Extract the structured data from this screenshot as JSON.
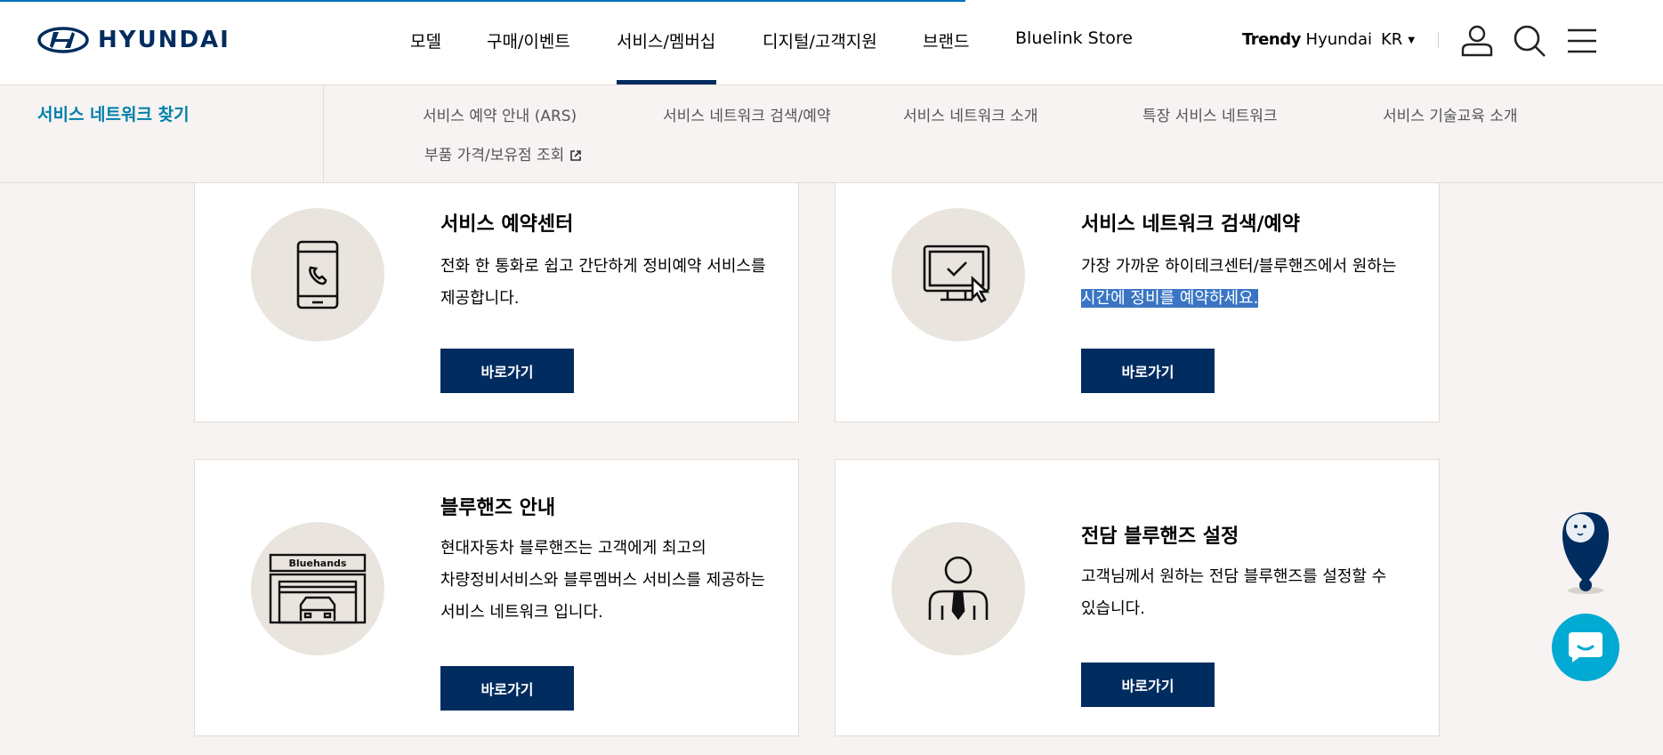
{
  "header": {
    "logo_text": "HYUNDAI",
    "nav": [
      {
        "label": "모델"
      },
      {
        "label": "구매/이벤트"
      },
      {
        "label": "서비스/멤버십"
      },
      {
        "label": "디지털/고객지원"
      },
      {
        "label": "브랜드"
      },
      {
        "label": "Bluelink Store"
      }
    ],
    "active_nav": "서비스/멤버십",
    "trendy_bold": "Trendy",
    "trendy_rest": " Hyundai",
    "lang": "KR",
    "lang_caret": "▼",
    "icons": [
      "user-icon",
      "search-icon",
      "menu-icon"
    ]
  },
  "subnav": {
    "title": "서비스 네트워크 찾기",
    "links": [
      "서비스 예약 안내 (ARS)",
      "서비스 네트워크 검색/예약",
      "서비스 네트워크 소개",
      "특장 서비스 네트워크",
      "서비스 기술교육 소개",
      "부품 가격/보유점 조회"
    ]
  },
  "cards": [
    {
      "title": "서비스 예약센터",
      "desc_line1": "전화 한 통화로 쉽고 간단하게 정비예약 서비스를",
      "desc_line2": "제공합니다.",
      "button": "바로가기",
      "icon": "phone-icon"
    },
    {
      "title": "서비스 네트워크 검색/예약",
      "desc_line1": "가장 가까운 하이테크센터/블루핸즈에서 원하는",
      "desc_line2": "시간에 정비를 예약하세요.",
      "button": "바로가기",
      "icon": "monitor-check-icon"
    },
    {
      "title": "블루핸즈 안내",
      "desc_line1": "현대자동차 블루핸즈는 고객에게 최고의",
      "desc_line2": "차량정비서비스와 블루멤버스 서비스를 제공하는",
      "desc_line3": "서비스 네트워크 입니다.",
      "button": "바로가기",
      "icon": "bluehands-shop-icon",
      "icon_sign": "Bluehands"
    },
    {
      "title": "전담 블루핸즈 설정",
      "desc_line1": "고객님께서 원하는 전담 블루핸즈를 설정할 수",
      "desc_line2": "있습니다.",
      "button": "바로가기",
      "icon": "person-tie-icon"
    }
  ],
  "floating": {
    "chatbot_icon": "chatbot-mascot-icon",
    "chat_icon": "chat-bubble-icon"
  },
  "colors": {
    "brand_navy": "#002c5f",
    "accent_blue": "#007fa8",
    "chat_cyan": "#00aad2",
    "selection": "#3a75c4",
    "page_bg": "#f6f3f2"
  }
}
